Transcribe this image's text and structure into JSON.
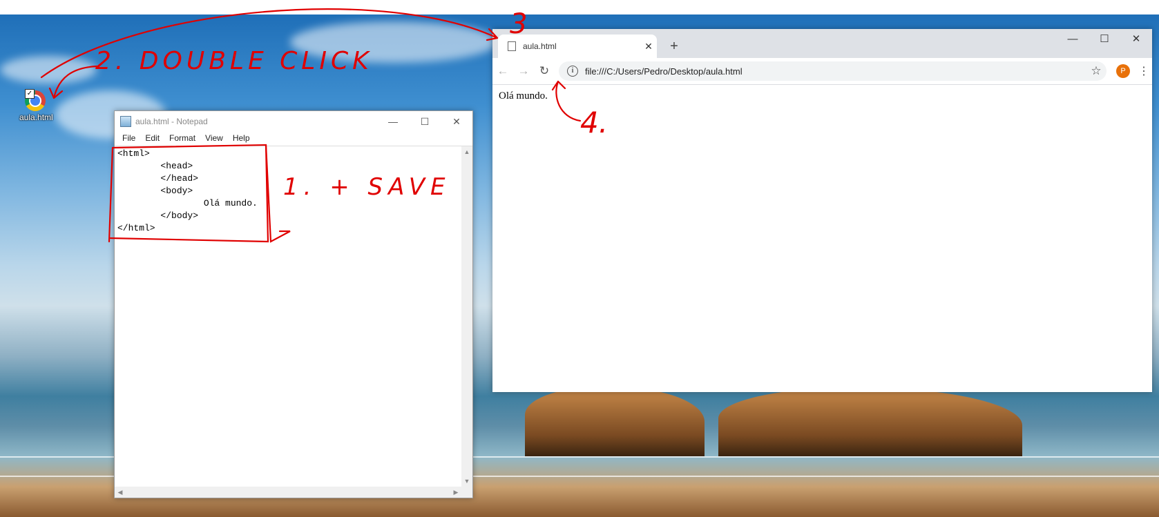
{
  "desktop": {
    "icon_label": "aula.html"
  },
  "notepad": {
    "title": "aula.html - Notepad",
    "menu": [
      "File",
      "Edit",
      "Format",
      "View",
      "Help"
    ],
    "content": "<html>\n        <head>\n        </head>\n        <body>\n                Olá mundo.\n        </body>\n</html>"
  },
  "chrome": {
    "tab_title": "aula.html",
    "new_tab": "+",
    "url": "file:///C:/Users/Pedro/Desktop/aula.html",
    "avatar_letter": "P",
    "page_text": "Olá mundo."
  },
  "annotations": {
    "step1": "1. + SAVE",
    "step2": "2. DOUBLE CLICK",
    "step3": "3",
    "step4": "4."
  },
  "colors": {
    "annotation": "#e00000",
    "chrome_tabstrip": "#dee1e6",
    "avatar": "#e8710a"
  }
}
